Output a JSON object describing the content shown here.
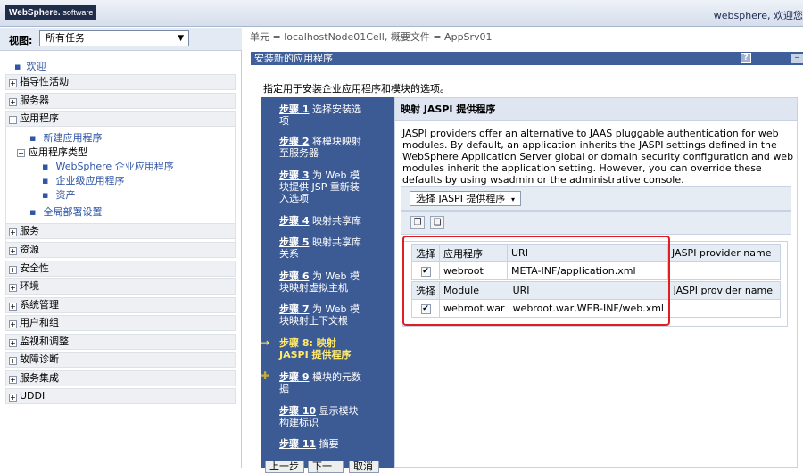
{
  "banner": {
    "brand": "WebSphere.",
    "brand_suffix": "software",
    "welcome": "websphere, 欢迎您"
  },
  "nav": {
    "view_label": "视图:",
    "view_value": "所有任务",
    "welcome": "欢迎",
    "categories": [
      "指导性活动",
      "服务器",
      "应用程序",
      "服务",
      "资源",
      "安全性",
      "环境",
      "系统管理",
      "用户和组",
      "监视和调整",
      "故障诊断",
      "服务集成",
      "UDDI"
    ],
    "apps_sub": {
      "new_app": "新建应用程序",
      "app_types": "应用程序类型",
      "type_items": [
        "WebSphere 企业应用程序",
        "企业级应用程序",
        "资产"
      ],
      "global_deploy": "全局部署设置"
    }
  },
  "content": {
    "breadcrumb": "单元 = localhostNode01Cell, 概要文件 = AppSrv01",
    "panel_title": "安装新的应用程序",
    "help": "?",
    "intro": "指定用于安装企业应用程序和模块的选项。",
    "steps": [
      {
        "num": "步骤 1",
        "text": "选择安装选项"
      },
      {
        "num": "步骤 2",
        "text": "将模块映射至服务器"
      },
      {
        "num": "步骤 3",
        "text": "为 Web 模块提供 JSP 重新装入选项"
      },
      {
        "num": "步骤 4",
        "text": "映射共享库"
      },
      {
        "num": "步骤 5",
        "text": "映射共享库关系"
      },
      {
        "num": "步骤 6",
        "text": "为 Web 模块映射虚拟主机"
      },
      {
        "num": "步骤 7",
        "text": "为 Web 模块映射上下文根"
      },
      {
        "num": "步骤 8:",
        "text": "映射 JASPI 提供程序"
      },
      {
        "num": "步骤 9",
        "text": "模块的元数据"
      },
      {
        "num": "步骤 10",
        "text": "显示模块构建标识"
      },
      {
        "num": "步骤 11",
        "text": "摘要"
      }
    ],
    "main_title": "映射 JASPI 提供程序",
    "description": "JASPI providers offer an alternative to JAAS pluggable authentication for web modules. By default, an application inherits the JASPI settings defined in the WebSphere Application Server global or domain security configuration and web modules inherit the application setting. However, you can override these defaults by using wsadmin or the administrative console.",
    "select_button": "选择 JASPI 提供程序",
    "table1": {
      "headers": [
        "选择",
        "应用程序",
        "URI",
        "JASPI provider name"
      ],
      "row": [
        "webroot",
        "META-INF/application.xml",
        ""
      ]
    },
    "table2": {
      "headers": [
        "选择",
        "Module",
        "URI",
        "JASPI provider name"
      ],
      "row": [
        "webroot.war",
        "webroot.war,WEB-INF/web.xml",
        ""
      ]
    },
    "buttons": [
      "上一步",
      "下一步",
      "取消"
    ]
  }
}
